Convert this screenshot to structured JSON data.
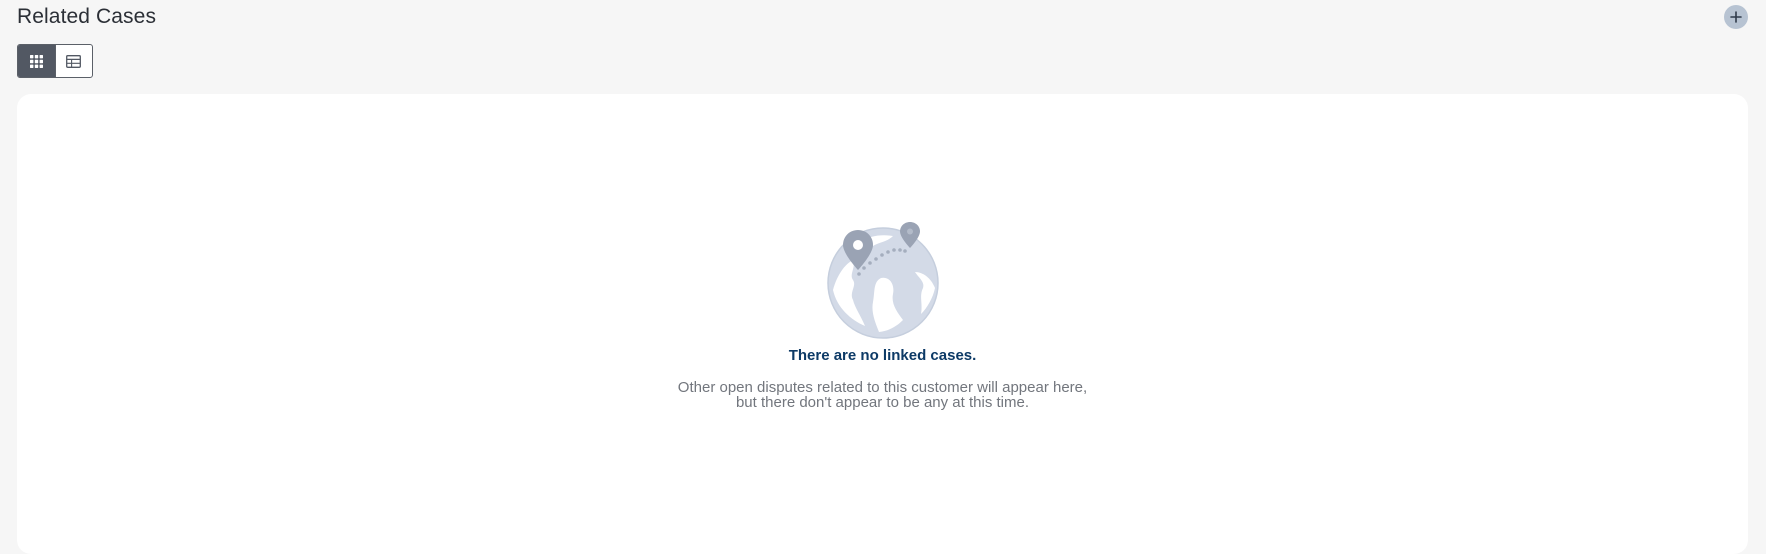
{
  "header": {
    "title": "Related Cases",
    "add_icon": "plus-icon"
  },
  "view_toggle": {
    "options": [
      {
        "name": "grid-view",
        "icon": "grid-icon",
        "active": true
      },
      {
        "name": "table-view",
        "icon": "table-icon",
        "active": false
      }
    ]
  },
  "empty_state": {
    "illustration": "globe-with-pins-icon",
    "title": "There are no linked cases.",
    "description_line1": "Other open disputes related to this customer will appear here,",
    "description_line2": "but there don't appear to be any at this time."
  },
  "colors": {
    "background": "#f6f6f6",
    "panel": "#ffffff",
    "title_accent": "#0d3a66",
    "toggle_active": "#525863"
  }
}
